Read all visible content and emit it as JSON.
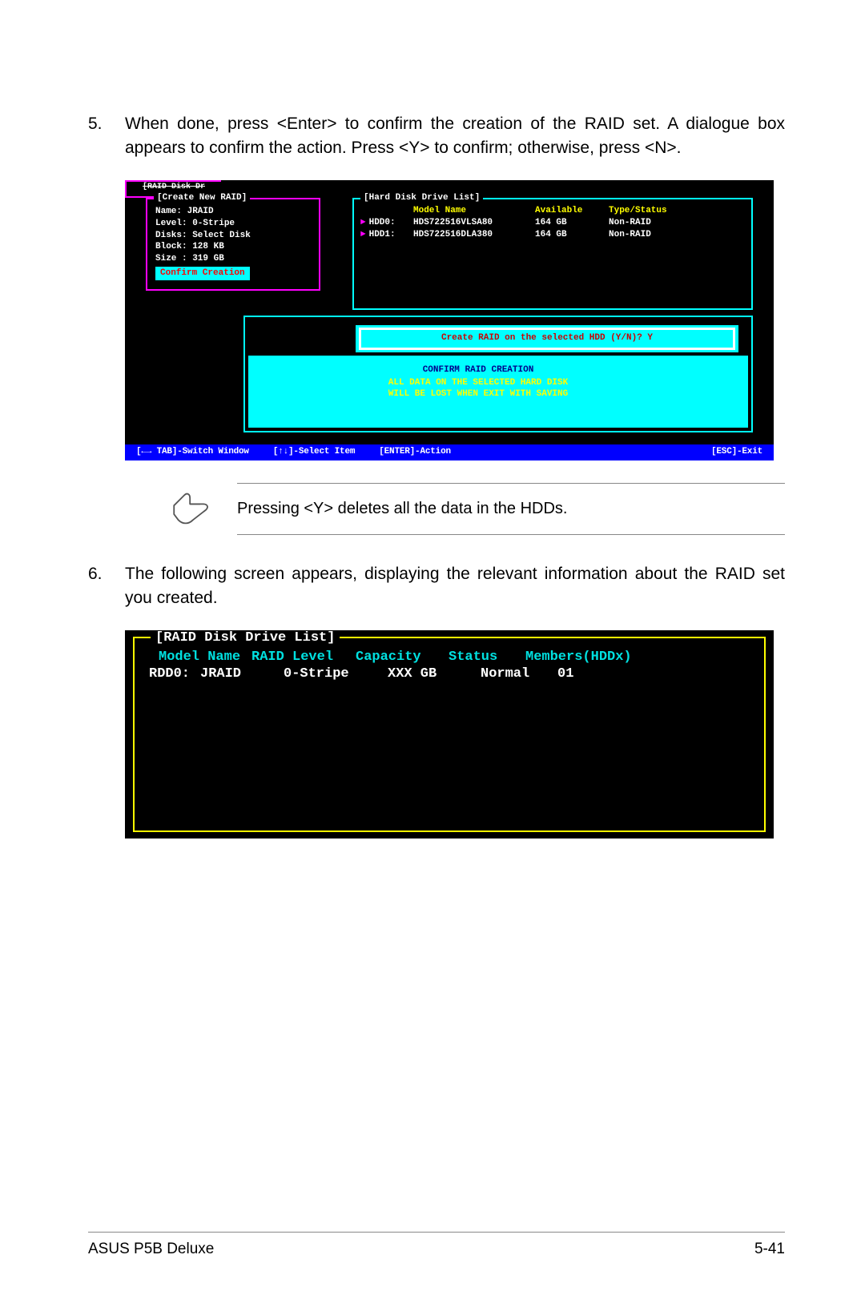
{
  "steps": [
    {
      "num": "5.",
      "text": "When done, press <Enter> to confirm the creation of the RAID set. A dialogue box appears to confirm the action. Press <Y> to confirm; otherwise, press <N>."
    },
    {
      "num": "6.",
      "text": "The following screen appears, displaying the relevant information about the RAID set you created."
    }
  ],
  "bios1": {
    "create_raid": {
      "title": "[Create New RAID]",
      "lines": {
        "l1": "Name: JRAID",
        "l2": "Level: 0-Stripe",
        "l3": "Disks: Select Disk",
        "l4": "Block: 128 KB",
        "l5": "Size : 319 GB"
      },
      "confirm": "Confirm Creation"
    },
    "hdd_list": {
      "title": "[Hard Disk Drive List]",
      "headers": {
        "model": "Model Name",
        "avail": "Available",
        "type": "Type/Status"
      },
      "rows": [
        {
          "id": "HDD0:",
          "model": "HDS722516VLSA80",
          "avail": "164 GB",
          "type": "Non-RAID"
        },
        {
          "id": "HDD1:",
          "model": "HDS722516DLA380",
          "avail": "164 GB",
          "type": "Non-RAID"
        }
      ]
    },
    "raid_stub": "[RAID Disk Dr",
    "dialog": {
      "prompt": "Create RAID on the selected HDD (Y/N)? Y",
      "confirm_title": "CONFIRM RAID CREATION",
      "warn1": "ALL DATA ON THE SELECTED HARD DISK",
      "warn2": "WILL BE LOST WHEN EXIT WITH SAVING"
    },
    "bar": {
      "b1": "[←→ TAB]-Switch Window",
      "b2": "[↑↓]-Select Item",
      "b3": "[ENTER]-Action",
      "b4": "[ESC]-Exit"
    }
  },
  "note_text": "Pressing <Y> deletes all the data in the HDDs.",
  "bios2": {
    "title": "[RAID Disk Drive List]",
    "headers": {
      "model": "Model Name",
      "level": "RAID Level",
      "cap": "Capacity",
      "status": "Status",
      "mem": "Members(HDDx)"
    },
    "row": {
      "id": "RDD0:",
      "model": "JRAID",
      "level": "0-Stripe",
      "cap": "XXX GB",
      "status": "Normal",
      "mem": "01"
    }
  },
  "footer": {
    "left": "ASUS P5B Deluxe",
    "right": "5-41"
  }
}
